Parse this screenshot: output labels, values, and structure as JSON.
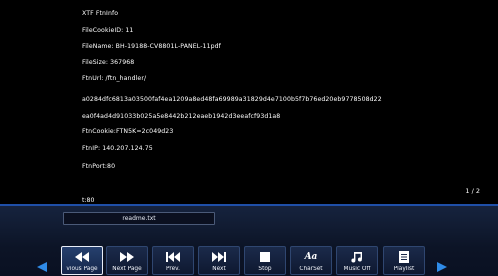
{
  "info": {
    "lines": [
      "XTF FtnInfo",
      "FileCookieID: 11",
      "FileName: BH-19188-CV8801L-PANEL-11pdf",
      "FileSize: 367968",
      "FtnUrl: /ftn_handler/",
      "a0284dfc6813a03500faf4ea1209a8ed48fa69989a31829d4e7100b5f7b76ed20eb9778508d22",
      "ea0f4ad4d91033b025a5e8442b212eaeb1942d3eeafcf93d1a8",
      "FtnCookie:FTN5K=2c049d23",
      "FtnIP: 140.207.124.75",
      "FtnPort:80"
    ]
  },
  "page_indicator": "1 / 2",
  "time": "t:80",
  "filename": "readme.txt",
  "toolbar": {
    "buttons": [
      {
        "label": "vious Page",
        "icon": "rewind-icon"
      },
      {
        "label": "Next Page",
        "icon": "fast-forward-icon"
      },
      {
        "label": "Prev.",
        "icon": "skip-previous-icon"
      },
      {
        "label": "Next",
        "icon": "skip-next-icon"
      },
      {
        "label": "Stop",
        "icon": "stop-icon"
      },
      {
        "label": "CharSet",
        "icon": "charset-icon"
      },
      {
        "label": "Music Off",
        "icon": "music-note-icon"
      },
      {
        "label": "Playlist",
        "icon": "playlist-icon"
      }
    ]
  },
  "charset_icon_text": "Aa",
  "colors": {
    "accent": "#2f8be8",
    "divider": "#1f4fa8",
    "toolbar_bg": "#0c1426"
  }
}
